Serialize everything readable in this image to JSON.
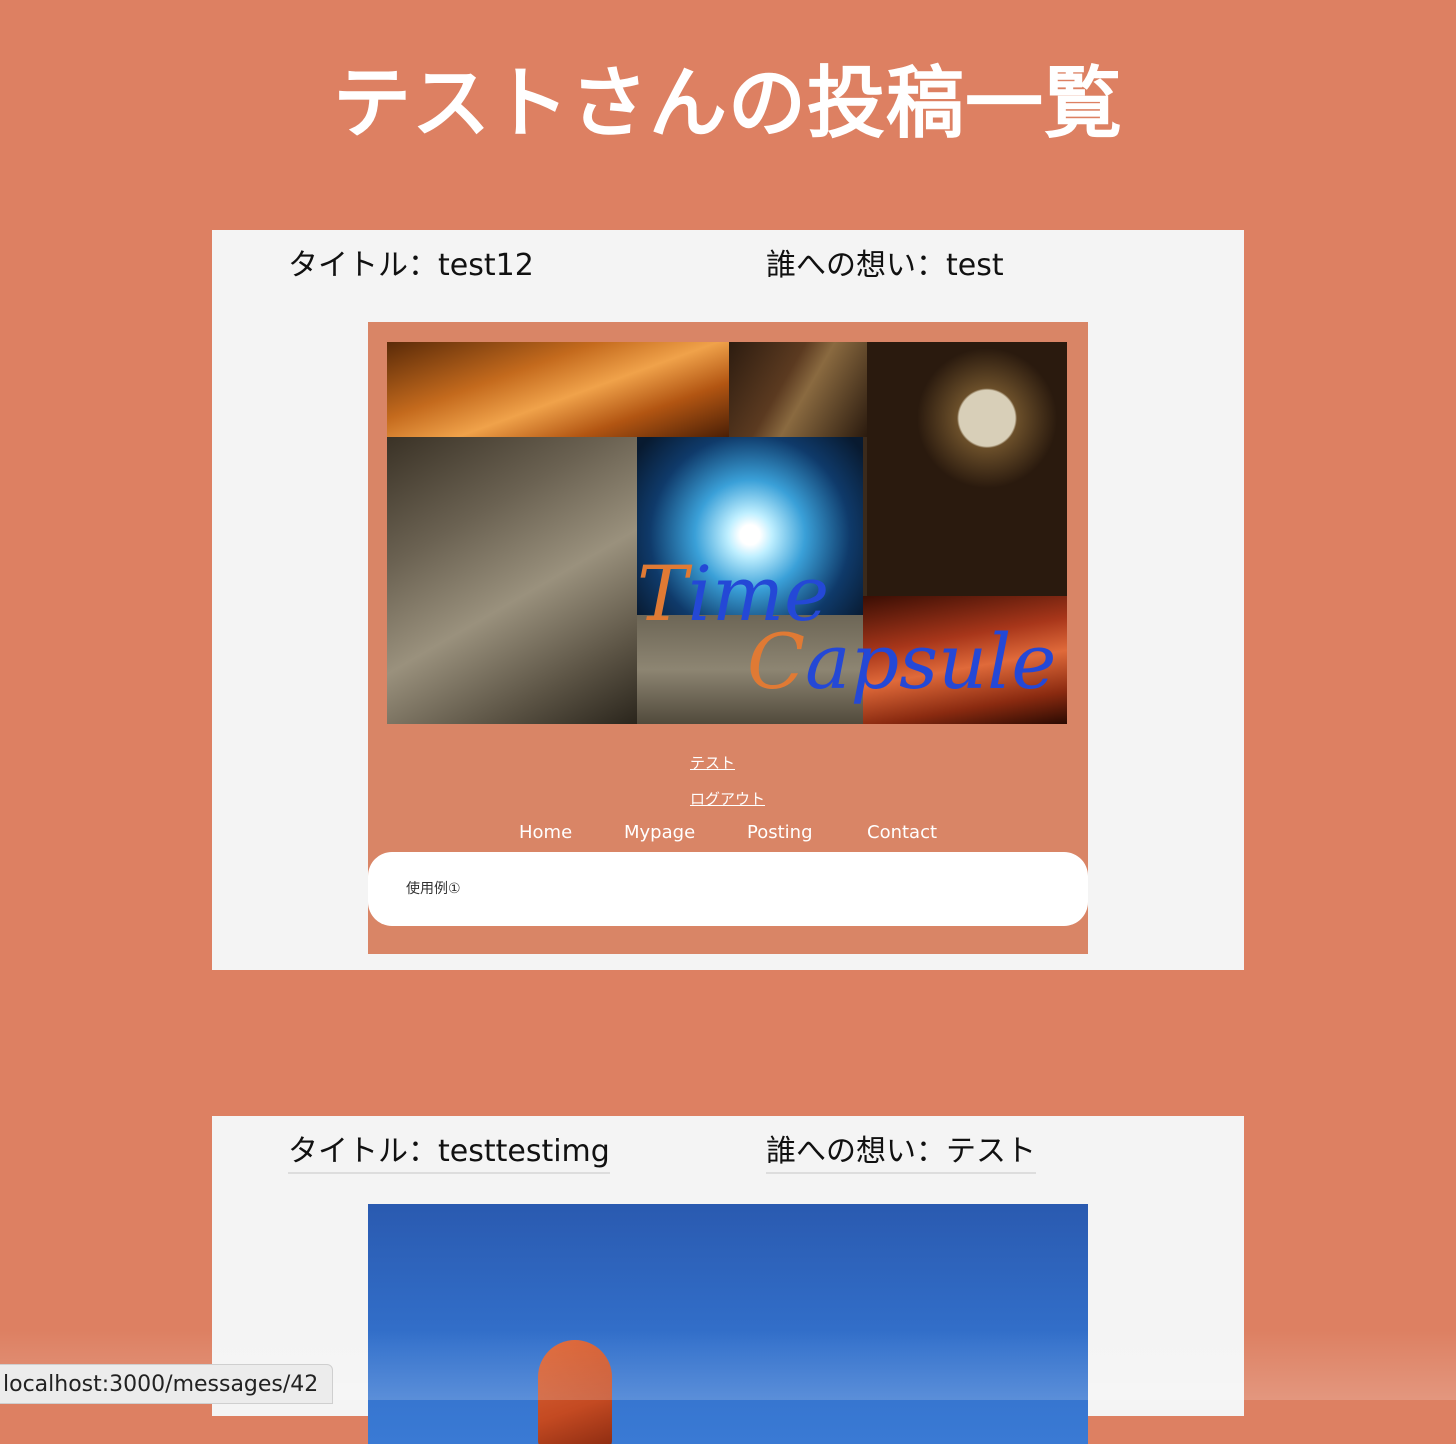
{
  "page": {
    "title": "テストさんの投稿一覧"
  },
  "posts": [
    {
      "title_line": "タイトル：test12",
      "to_line": "誰への想い：test",
      "image": {
        "logo_first": "T",
        "logo_rest": "ime",
        "logo2_first": "C",
        "logo2_rest": "apsule",
        "user_link": "テスト",
        "logout_link": "ログアウト",
        "menu": [
          "Home",
          "Mypage",
          "Posting",
          "Contact"
        ],
        "search_text": "使用例①"
      }
    },
    {
      "title_line": "タイトル：testtestimg",
      "to_line": "誰への想い：テスト"
    }
  ],
  "status_bar": {
    "url": "localhost:3000/messages/42"
  },
  "colors": {
    "background": "#dd8062",
    "card": "#f4f4f4",
    "title_text": "#ffffff",
    "logo_blue": "#2448d6",
    "logo_orange": "#e07a34"
  }
}
